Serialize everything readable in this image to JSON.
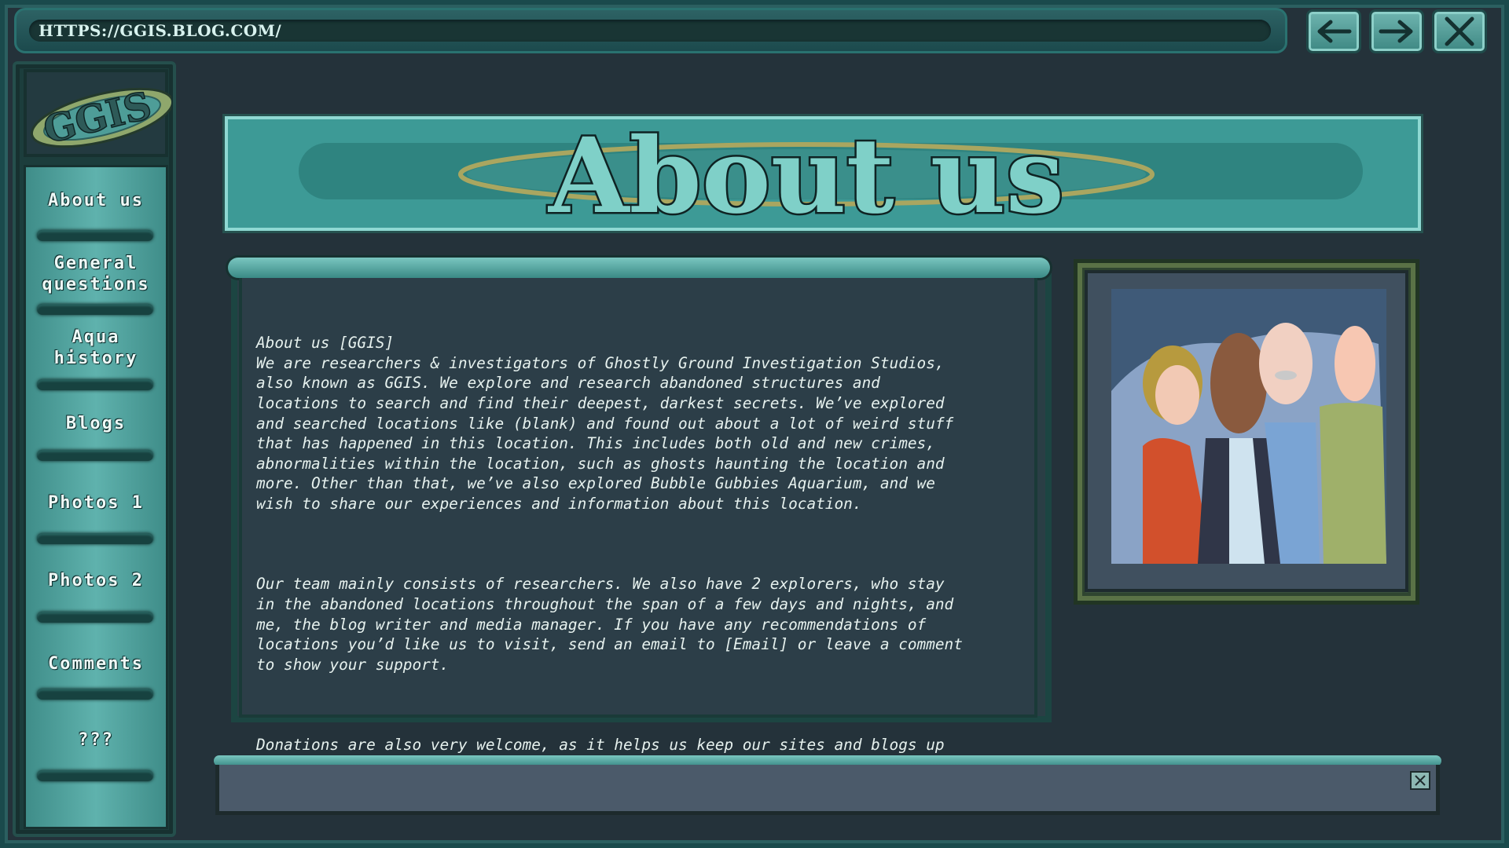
{
  "browser": {
    "url": "HTTPS://GGIS.BLOG.COM/",
    "back_icon": "arrow-left-icon",
    "forward_icon": "arrow-right-icon",
    "close_icon": "close-icon"
  },
  "sidebar": {
    "logo_text": "GGIS",
    "items": [
      {
        "label": "About us"
      },
      {
        "label": "General\nquestions"
      },
      {
        "label": "Aqua\nhistory"
      },
      {
        "label": "Blogs"
      },
      {
        "label": "Photos 1"
      },
      {
        "label": "Photos 2"
      },
      {
        "label": "Comments"
      },
      {
        "label": "???"
      }
    ]
  },
  "banner": {
    "title": "About us"
  },
  "content": {
    "paragraphs": [
      "About us [GGIS]\nWe are researchers & investigators of Ghostly Ground Investigation Studios,\nalso known as GGIS. We explore and research abandoned structures and\nlocations to search and find their deepest, darkest secrets. We’ve explored\nand searched locations like (blank) and found out about a lot of weird stuff\nthat has happened in this location. This includes both old and new crimes,\nabnormalities within the location, such as ghosts haunting the location and\nmore. Other than that, we’ve also explored Bubble Gubbies Aquarium, and we\nwish to share our experiences and information about this location.",
      "Our team mainly consists of researchers. We also have 2 explorers, who stay\nin the abandoned locations throughout the span of a few days and nights, and\nme, the blog writer and media manager. If you have any recommendations of\nlocations you’d like us to visit, send an email to [Email] or leave a comment\nto show your support.",
      "Donations are also very welcome, as it helps us keep our sites and blogs up\nand going."
    ]
  },
  "photo": {
    "subject": "group-of-four-people"
  },
  "bottom_bar": {
    "close_icon": "close-icon"
  },
  "colors": {
    "accent": "#3d9a96",
    "dark": "#24323a",
    "text": "#e6f1ee"
  }
}
